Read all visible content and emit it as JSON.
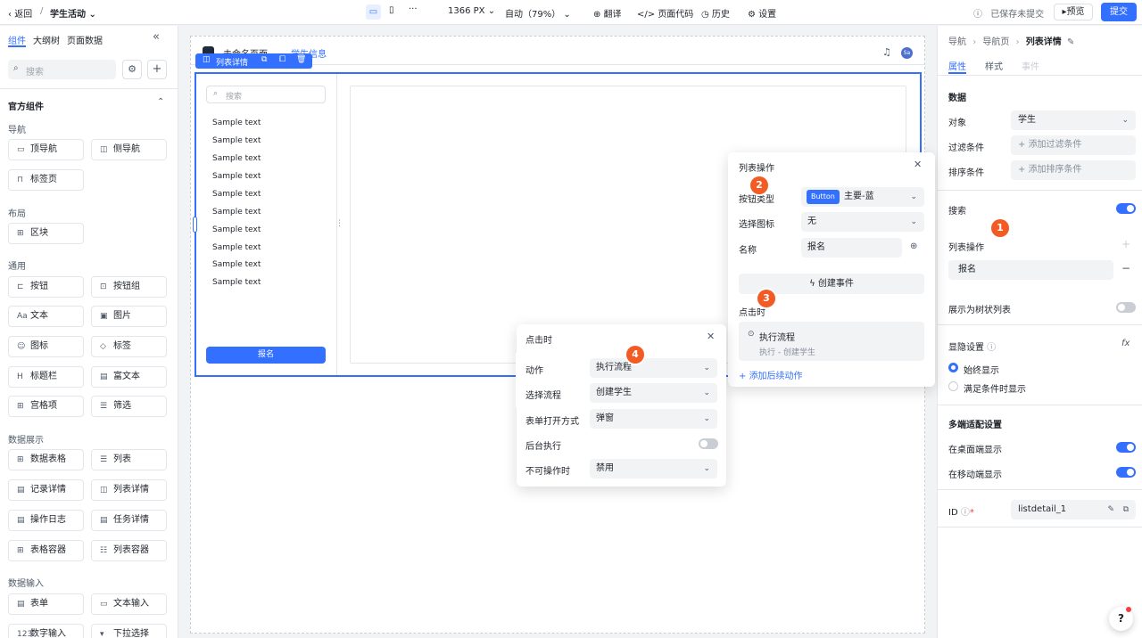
{
  "topbar": {
    "back": "返回",
    "separator": "/",
    "app_name": "学生活动",
    "width": "1366 PX",
    "zoom": "自动（79%）",
    "translate": "翻译",
    "page_code": "页面代码",
    "history": "历史",
    "settings": "设置",
    "saved_status": "已保存未提交",
    "preview": "预览",
    "submit": "提交"
  },
  "left": {
    "tabs": [
      "组件",
      "大纲树",
      "页面数据"
    ],
    "search_placeholder": "搜索",
    "official": "官方组件",
    "groups": {
      "nav": "导航",
      "layout": "布局",
      "general": "通用",
      "data_display": "数据展示",
      "data_input": "数据输入"
    },
    "items": {
      "top_nav": "顶导航",
      "side_nav": "侧导航",
      "tab_page": "标签页",
      "block": "区块",
      "button": "按钮",
      "button_group": "按钮组",
      "text": "文本",
      "image": "图片",
      "icon": "图标",
      "tag": "标签",
      "title_bar": "标题栏",
      "rich_text": "富文本",
      "grid_item": "宫格项",
      "filter": "筛选",
      "data_table": "数据表格",
      "list": "列表",
      "record_detail": "记录详情",
      "list_detail": "列表详情",
      "op_log": "操作日志",
      "task_detail": "任务详情",
      "table_container": "表格容器",
      "list_container": "列表容器",
      "form": "表单",
      "text_input": "文本输入",
      "number_input": "数字输入",
      "dropdown_select": "下拉选择"
    }
  },
  "canvas": {
    "page_title": "未命名页面",
    "page_tab": "学生信息",
    "component_tag": "列表详情",
    "avatar": "Sa",
    "search_placeholder": "搜索",
    "list_items": [
      "Sample text",
      "Sample text",
      "Sample text",
      "Sample text",
      "Sample text",
      "Sample text",
      "Sample text",
      "Sample text",
      "Sample text",
      "Sample text"
    ],
    "signup_button": "报名"
  },
  "right": {
    "breadcrumb": [
      "导航",
      "导航页",
      "列表详情"
    ],
    "tabs": [
      "属性",
      "样式",
      "事件"
    ],
    "data_title": "数据",
    "object_label": "对象",
    "object_value": "学生",
    "filter_label": "过滤条件",
    "filter_add": "添加过滤条件",
    "sort_label": "排序条件",
    "sort_add": "添加排序条件",
    "search_label": "搜索",
    "list_ops_label": "列表操作",
    "list_ops_item": "报名",
    "tree_label": "展示为树状列表",
    "visibility_title": "显隐设置",
    "always_show": "始终显示",
    "conditional_show": "满足条件时显示",
    "multi_title": "多端适配设置",
    "desktop_show": "在桌面端显示",
    "mobile_show": "在移动端显示",
    "id_label": "ID",
    "id_value": "listdetail_1"
  },
  "list_ops_popup": {
    "title": "列表操作",
    "button_type_label": "按钮类型",
    "button_badge": "Button",
    "button_type_value": "主要-蓝",
    "icon_label": "选择图标",
    "icon_value": "无",
    "name_label": "名称",
    "name_value": "报名",
    "create_event": "创建事件",
    "on_click": "点击时",
    "action_title": "执行流程",
    "action_detail": "执行 - 创建学生",
    "add_followup": "添加后续动作"
  },
  "click_popup": {
    "title": "点击时",
    "action_label": "动作",
    "action_value": "执行流程",
    "flow_label": "选择流程",
    "flow_value": "创建学生",
    "open_label": "表单打开方式",
    "open_value": "弹窗",
    "bg_label": "后台执行",
    "disabled_label": "不可操作时",
    "disabled_value": "禁用"
  },
  "badges": [
    "1",
    "2",
    "3",
    "4"
  ],
  "help_icon": "?",
  "colors": {
    "primary": "#3370ff",
    "badge": "#f25b24"
  }
}
